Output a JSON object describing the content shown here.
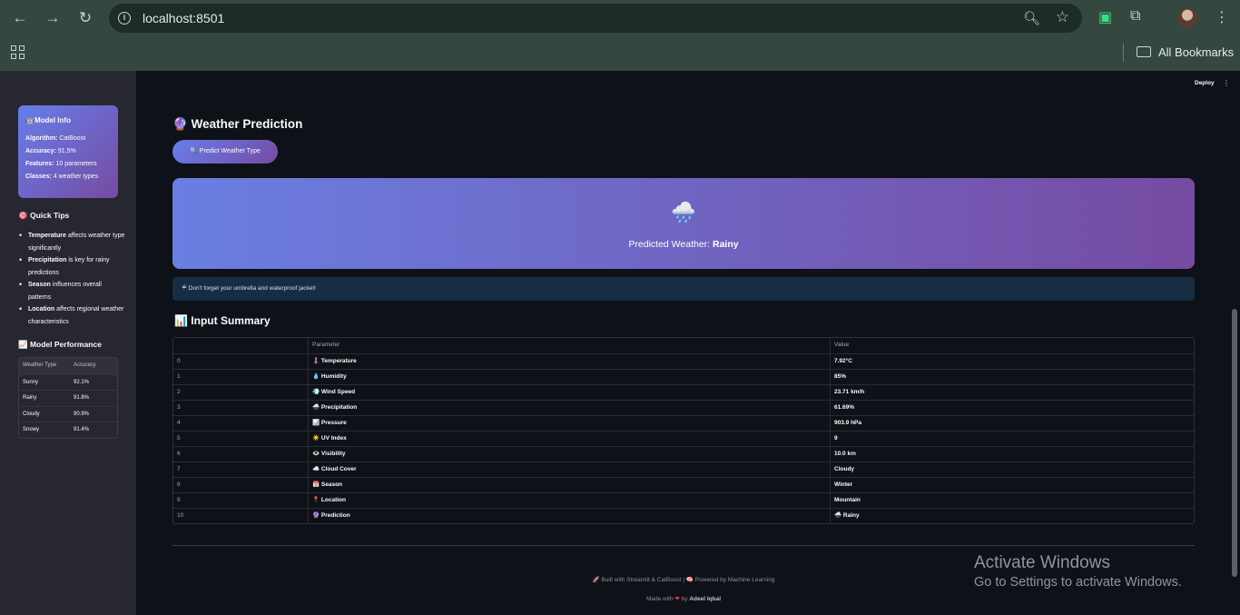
{
  "browser": {
    "url": "localhost:8501",
    "bookmarks_label": "All Bookmarks"
  },
  "sidebar": {
    "model_info": {
      "title": "Model Info",
      "title_icon": "🤖",
      "rows": [
        {
          "label": "Algorithm:",
          "value": "CatBoost"
        },
        {
          "label": "Accuracy:",
          "value": "91.5%"
        },
        {
          "label": "Features:",
          "value": "10 parameters"
        },
        {
          "label": "Classes:",
          "value": "4 weather types"
        }
      ]
    },
    "quick_tips": {
      "title": "Quick Tips",
      "icon": "🎯",
      "items": [
        {
          "bold": "Temperature",
          "text": "affects weather type significantly"
        },
        {
          "bold": "Precipitation",
          "text": "is key for rainy predictions"
        },
        {
          "bold": "Season",
          "text": "influences overall patterns"
        },
        {
          "bold": "Location",
          "text": "affects regional weather characteristics"
        }
      ]
    },
    "performance": {
      "title": "Model Performance",
      "icon": "📈",
      "headers": [
        "Weather Type",
        "Accuracy"
      ],
      "rows": [
        [
          "Sunny",
          "92.1%"
        ],
        [
          "Rainy",
          "91.8%"
        ],
        [
          "Cloudy",
          "90.9%"
        ],
        [
          "Snowy",
          "91.4%"
        ]
      ]
    }
  },
  "header": {
    "deploy_label": "Deploy",
    "menu_icon": "⋮"
  },
  "main": {
    "title": "Weather Prediction",
    "title_icon": "🔮",
    "predict_button": "🔍 Predict Weather Type",
    "result": {
      "emoji": "🌧️",
      "label": "Predicted Weather:",
      "value": "Rainy"
    },
    "alert": "☔ Don't forget your umbrella and waterproof jacket!",
    "summary": {
      "title": "Input Summary",
      "icon": "📊",
      "headers": [
        "",
        "Parameter",
        "Value"
      ],
      "rows": [
        [
          "0",
          "🌡️ Temperature",
          "7.92°C"
        ],
        [
          "1",
          "💧 Humidity",
          "85%"
        ],
        [
          "2",
          "💨 Wind Speed",
          "23.71 km/h"
        ],
        [
          "3",
          "🌧️ Precipitation",
          "61.69%"
        ],
        [
          "4",
          "📊 Pressure",
          "903.9 hPa"
        ],
        [
          "5",
          "☀️ UV Index",
          "9"
        ],
        [
          "6",
          "👁️ Visibility",
          "10.0 km"
        ],
        [
          "7",
          "☁️ Cloud Cover",
          "Cloudy"
        ],
        [
          "8",
          "📅 Season",
          "Winter"
        ],
        [
          "9",
          "📍 Location",
          "Mountain"
        ],
        [
          "10",
          "🔮 Prediction",
          "🌧️ Rainy"
        ]
      ]
    },
    "footer": {
      "line1": "🚀 Built with Streamlit & CatBoost | 🧠 Powered by Machine Learning",
      "line2_prefix": "Made with",
      "line2_by": "by",
      "line2_author": "Adeel Iqbal"
    }
  },
  "watermark": {
    "line1": "Activate Windows",
    "line2": "Go to Settings to activate Windows."
  }
}
